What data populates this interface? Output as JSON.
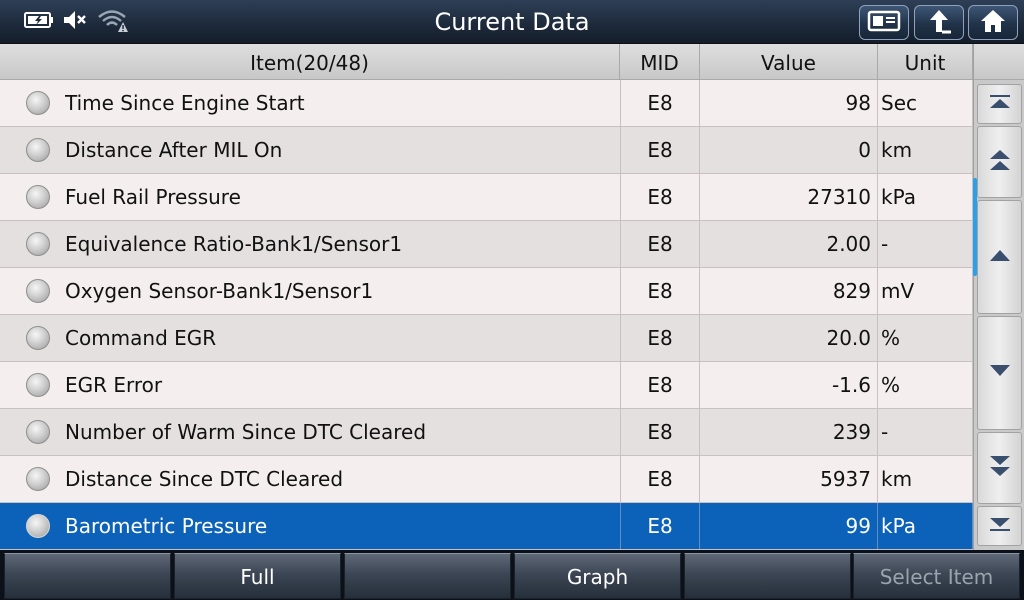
{
  "header": {
    "title": "Current Data"
  },
  "table": {
    "columns": {
      "item": "Item(20/48)",
      "mid": "MID",
      "value": "Value",
      "unit": "Unit"
    },
    "rows": [
      {
        "name": "Time Since Engine Start",
        "mid": "E8",
        "value": "98",
        "unit": "Sec"
      },
      {
        "name": "Distance After MIL On",
        "mid": "E8",
        "value": "0",
        "unit": "km"
      },
      {
        "name": "Fuel Rail Pressure",
        "mid": "E8",
        "value": "27310",
        "unit": "kPa"
      },
      {
        "name": "Equivalence Ratio-Bank1/Sensor1",
        "mid": "E8",
        "value": "2.00",
        "unit": "-"
      },
      {
        "name": "Oxygen Sensor-Bank1/Sensor1",
        "mid": "E8",
        "value": "829",
        "unit": "mV"
      },
      {
        "name": "Command EGR",
        "mid": "E8",
        "value": "20.0",
        "unit": "%"
      },
      {
        "name": "EGR Error",
        "mid": "E8",
        "value": "-1.6",
        "unit": "%"
      },
      {
        "name": "Number of Warm Since DTC Cleared",
        "mid": "E8",
        "value": "239",
        "unit": "-"
      },
      {
        "name": "Distance Since DTC Cleared",
        "mid": "E8",
        "value": "5937",
        "unit": "km"
      },
      {
        "name": "Barometric Pressure",
        "mid": "E8",
        "value": "99",
        "unit": "kPa"
      }
    ],
    "selected_row": 9
  },
  "bottom": {
    "buttons": [
      "",
      "Full",
      "",
      "Graph",
      "",
      "Select Item"
    ]
  },
  "colors": {
    "selection": "#0b62b8",
    "scroll_indicator": "#2aa0e8"
  },
  "icons": {
    "status": [
      "battery-charging-icon",
      "speaker-muted-icon",
      "wifi-warning-icon"
    ],
    "top_buttons": [
      "screenshot-icon",
      "back-arrow-icon",
      "home-icon"
    ],
    "scroll_buttons": [
      "scroll-top-icon",
      "page-up-icon",
      "line-up-icon",
      "line-down-icon",
      "page-down-icon",
      "scroll-bottom-icon"
    ]
  }
}
